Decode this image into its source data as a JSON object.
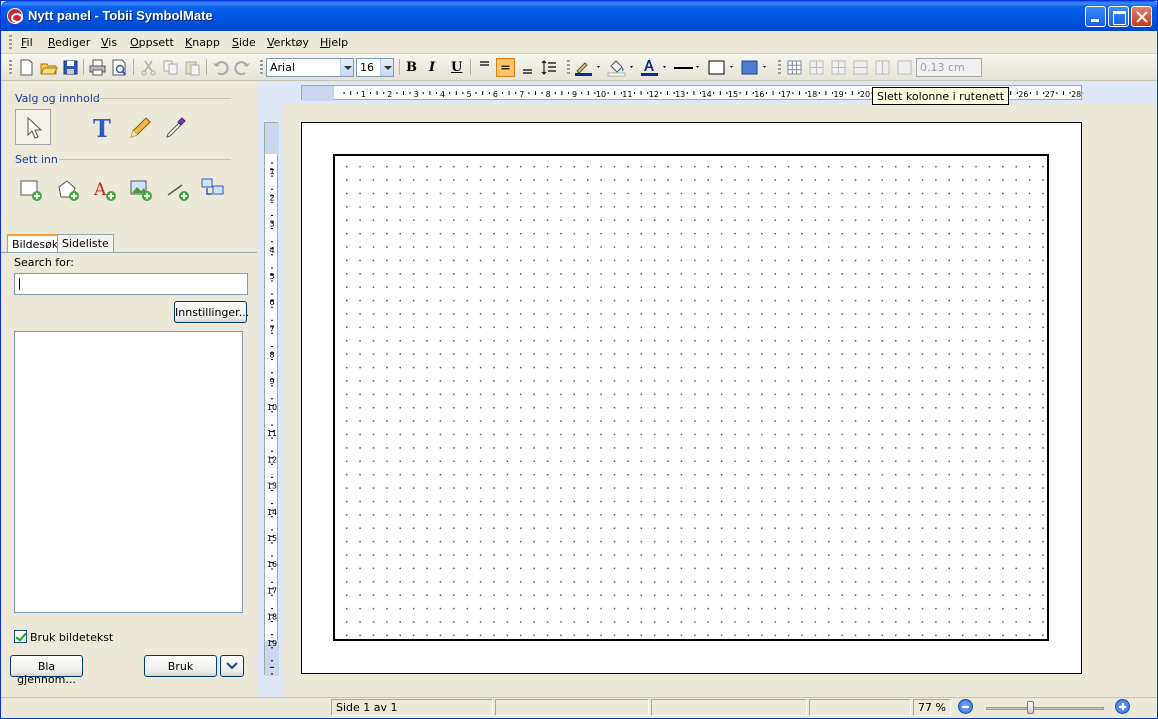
{
  "window": {
    "title": "Nytt panel - Tobii SymbolMate"
  },
  "menu": [
    {
      "label": "Fil",
      "u": "F",
      "rest": "il"
    },
    {
      "label": "Rediger",
      "u": "R",
      "rest": "ediger"
    },
    {
      "label": "Vis",
      "u": "V",
      "rest": "is"
    },
    {
      "label": "Oppsett",
      "u": "O",
      "rest": "ppsett"
    },
    {
      "label": "Knapp",
      "u": "K",
      "rest": "napp"
    },
    {
      "label": "Side",
      "u": "S",
      "rest": "ide"
    },
    {
      "label": "Verktøy",
      "u": "V",
      "rest": "erktøy"
    },
    {
      "label": "Hjelp",
      "u": "H",
      "rest": "jelp"
    }
  ],
  "toolbar": {
    "font": "Arial",
    "size": "16",
    "bold": "B",
    "italic": "I",
    "underline": "U",
    "line_width": "0.13 cm"
  },
  "left": {
    "group_content": "Valg og innhold",
    "group_insert": "Sett inn",
    "tabs": [
      "Bildesøk",
      "Sideliste"
    ],
    "search_label": "Search for:",
    "search_value": "",
    "settings_button": "Innstillinger...",
    "use_caption": "Bruk bildetekst",
    "browse_button": "Bla gjennom...",
    "use_button": "Bruk"
  },
  "ruler": {
    "h_labels": [
      "1",
      "2",
      "3",
      "4",
      "5",
      "6",
      "7",
      "8",
      "9",
      "10",
      "11",
      "12",
      "13",
      "14",
      "15",
      "16",
      "17",
      "18",
      "19",
      "20"
    ],
    "h_labels_right": [
      "25",
      "26",
      "27",
      "28"
    ],
    "v_labels": [
      "1",
      "2",
      "3",
      "4",
      "5",
      "6",
      "7",
      "8",
      "9",
      "10",
      "11",
      "12",
      "13",
      "14",
      "15",
      "16",
      "17",
      "18",
      "19"
    ]
  },
  "tooltip": "Slett kolonne i rutenett",
  "status": {
    "page": "Side 1 av 1",
    "zoom": "77 %"
  }
}
